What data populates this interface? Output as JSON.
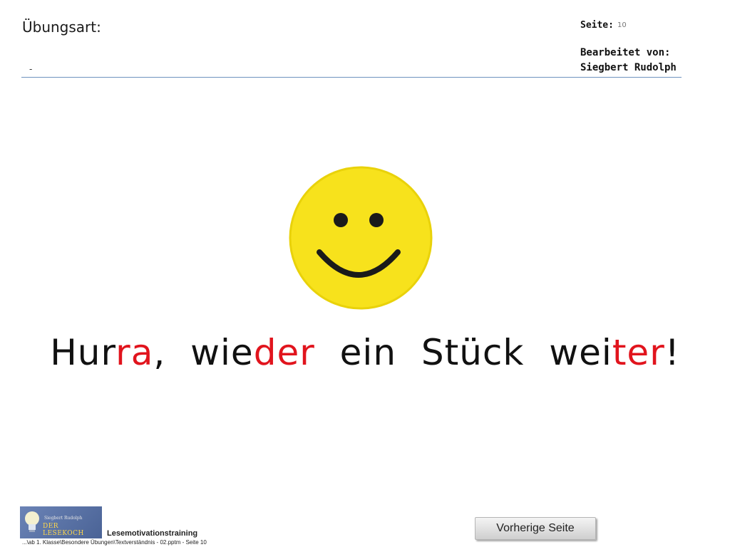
{
  "header": {
    "exercise_label": "Übungsart:",
    "exercise_value": "-",
    "page_label": "Seite:",
    "page_number": "10",
    "edited_by_label": "Bearbeitet von:",
    "author": "Siegbert Rudolph"
  },
  "main": {
    "image": "smiley-face",
    "message_parts": {
      "p1": "Hur",
      "p2": "ra",
      "p3": ", wie",
      "p4": "der",
      "p5": " ein Stück wei",
      "p6": "ter",
      "p7": "!"
    },
    "highlight_color": "#e1141d"
  },
  "footer": {
    "logo_name": "Siegbert Rudolph",
    "logo_brand": "DER LESEKOCH",
    "program_name": "Lesemotivationstraining",
    "file_path": "...\\ab 1. Klasse\\Besondere Übungen\\Textverständnis - 02.pptm - Seite 10",
    "prev_button_label": "Vorherige Seite"
  },
  "colors": {
    "rule": "#6f93bf",
    "smiley": "#f7e21c"
  }
}
